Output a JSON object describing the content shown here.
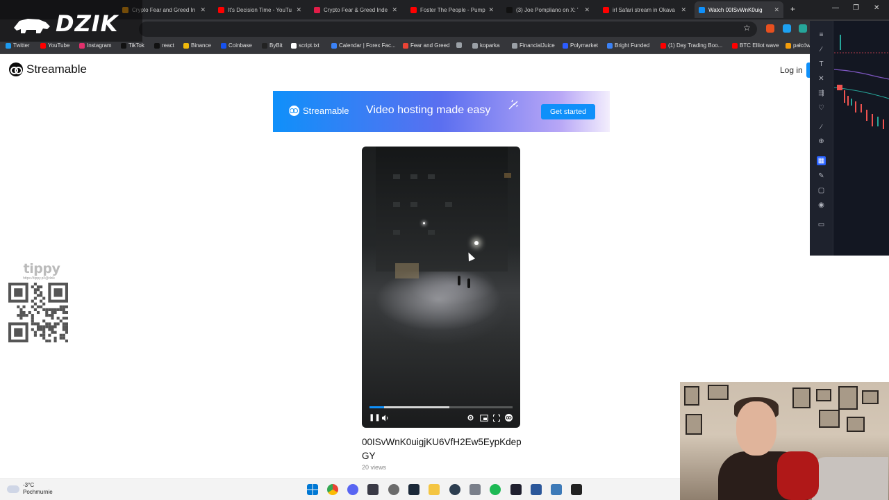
{
  "browser": {
    "tabs": [
      {
        "title": "Crypto Fear and Greed In",
        "color": "#f59e0b"
      },
      {
        "title": "It's Decision Time - YouTu",
        "color": "#ff0000"
      },
      {
        "title": "Crypto Fear & Greed Inde",
        "color": "#e11d48"
      },
      {
        "title": "Foster The People - Pump",
        "color": "#ff0000"
      },
      {
        "title": "(3) Joe Pompliano on X: '",
        "color": "#111111"
      },
      {
        "title": "irl Safari stream in Okava",
        "color": "#ff0000"
      },
      {
        "title": "Watch 00ISvWnK0uig",
        "color": "#0f90fa"
      }
    ],
    "new_tab": "+",
    "window_controls": [
      "—",
      "❐",
      "✕"
    ],
    "bookmark_star": "☆",
    "bookmarks": [
      {
        "label": "Twitter",
        "color": "#1d9bf0"
      },
      {
        "label": "YouTube",
        "color": "#ff0000"
      },
      {
        "label": "Instagram",
        "color": "#e1306c"
      },
      {
        "label": "TikTok",
        "color": "#111111"
      },
      {
        "label": "react",
        "color": "#111111"
      },
      {
        "label": "Binance",
        "color": "#f0b90b"
      },
      {
        "label": "Coinbase",
        "color": "#1652f0"
      },
      {
        "label": "ByBit",
        "color": "#222222"
      },
      {
        "label": "script.txt",
        "color": "#ffffff"
      },
      {
        "label": "Calendar | Forex Fac...",
        "color": "#3b82f6"
      },
      {
        "label": "Fear and Greed",
        "color": "#ea4335"
      },
      {
        "label": "",
        "color": "#9aa0a6"
      },
      {
        "label": "koparka",
        "color": "#9aa0a6"
      },
      {
        "label": "FinancialJuice",
        "color": "#9aa0a6"
      },
      {
        "label": "Polymarket",
        "color": "#2c5cff"
      },
      {
        "label": "Bright Funded",
        "color": "#3b82f6"
      },
      {
        "label": "(1) Day Trading Boo...",
        "color": "#ff0000"
      },
      {
        "label": "BTC Elliot wave",
        "color": "#ff0000"
      },
      {
        "label": "pałców",
        "color": "#f59e0b"
      }
    ]
  },
  "overlay": {
    "brand": "DZIK"
  },
  "site": {
    "logo": "Streamable",
    "login": "Log in"
  },
  "banner": {
    "logo": "Streamable",
    "tagline": "Video hosting made easy",
    "cta": "Get started"
  },
  "player": {
    "progress_played": 0.1,
    "progress_buffered": 0.56
  },
  "video": {
    "title": "00ISvWnK0uigjKU6VfH2Ew5EypKdepGY",
    "views": "20 views"
  },
  "tippy": {
    "logo": "tippy",
    "url": "https://tippy.pl/@dzik"
  },
  "taskbar": {
    "temp": "-3°C",
    "condition": "Pochmurnie"
  }
}
